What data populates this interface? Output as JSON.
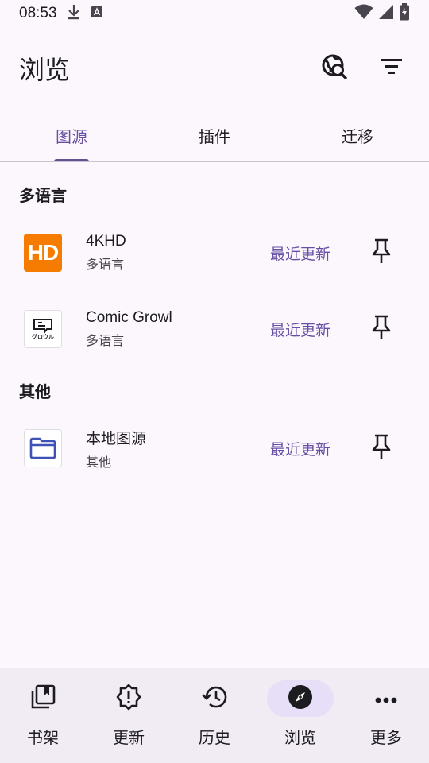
{
  "status_bar": {
    "time": "08:53",
    "icons_left": [
      "download-icon",
      "a-badge-icon"
    ],
    "icons_right": [
      "wifi-icon",
      "signal-icon",
      "battery-icon"
    ]
  },
  "app_bar": {
    "title": "浏览",
    "actions": [
      "global-search-icon",
      "filter-icon"
    ]
  },
  "tabs": [
    {
      "label": "图源",
      "active": true
    },
    {
      "label": "插件",
      "active": false
    },
    {
      "label": "迁移",
      "active": false
    }
  ],
  "sections": [
    {
      "header": "多语言",
      "sources": [
        {
          "name": "4KHD",
          "lang": "多语言",
          "latest": "最近更新",
          "logo": "hd-logo",
          "logo_text": "HD"
        },
        {
          "name": "Comic Growl",
          "lang": "多语言",
          "latest": "最近更新",
          "logo": "comic-growl-logo",
          "logo_text": "グロウル"
        }
      ]
    },
    {
      "header": "其他",
      "sources": [
        {
          "name": "本地图源",
          "lang": "其他",
          "latest": "最近更新",
          "logo": "folder-logo"
        }
      ]
    }
  ],
  "bottom_nav": [
    {
      "label": "书架",
      "icon": "library-icon",
      "active": false
    },
    {
      "label": "更新",
      "icon": "updates-icon",
      "active": false
    },
    {
      "label": "历史",
      "icon": "history-icon",
      "active": false
    },
    {
      "label": "浏览",
      "icon": "browse-compass-icon",
      "active": true
    },
    {
      "label": "更多",
      "icon": "more-icon",
      "active": false
    }
  ],
  "colors": {
    "accent": "#6750a4",
    "background": "#fcf7fd",
    "nav_background": "#f1ecf4",
    "nav_active_pill": "#e7def8",
    "hd_orange": "#f57c00"
  }
}
